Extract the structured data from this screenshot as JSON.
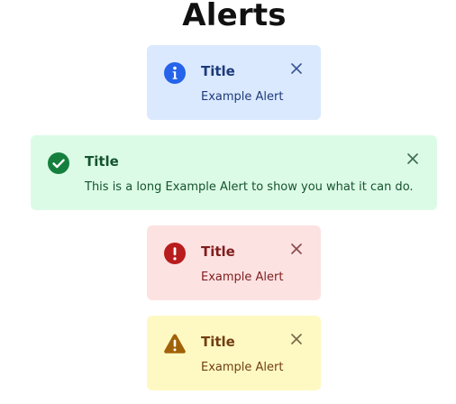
{
  "page": {
    "title": "Alerts"
  },
  "alerts": [
    {
      "variant": "info",
      "icon": "info-icon",
      "title": "Title",
      "message": "Example Alert",
      "close_icon": "close-icon",
      "colors": {
        "background": "#dbe9ff",
        "icon": "#2563eb",
        "text": "#1d3b7a"
      }
    },
    {
      "variant": "success",
      "icon": "check-circle-icon",
      "title": "Title",
      "message": "This is a long Example Alert to show you what it can do.",
      "close_icon": "close-icon",
      "colors": {
        "background": "#dcfbe7",
        "icon": "#15803d",
        "text": "#14532d"
      }
    },
    {
      "variant": "error",
      "icon": "exclamation-circle-icon",
      "title": "Title",
      "message": "Example Alert",
      "close_icon": "close-icon",
      "colors": {
        "background": "#fde2e2",
        "icon": "#b91c1c",
        "text": "#7f1d1d"
      }
    },
    {
      "variant": "warning",
      "icon": "warning-triangle-icon",
      "title": "Title",
      "message": "Example Alert",
      "close_icon": "close-icon",
      "colors": {
        "background": "#fef9c3",
        "icon": "#a16207",
        "text": "#713f12"
      }
    }
  ]
}
